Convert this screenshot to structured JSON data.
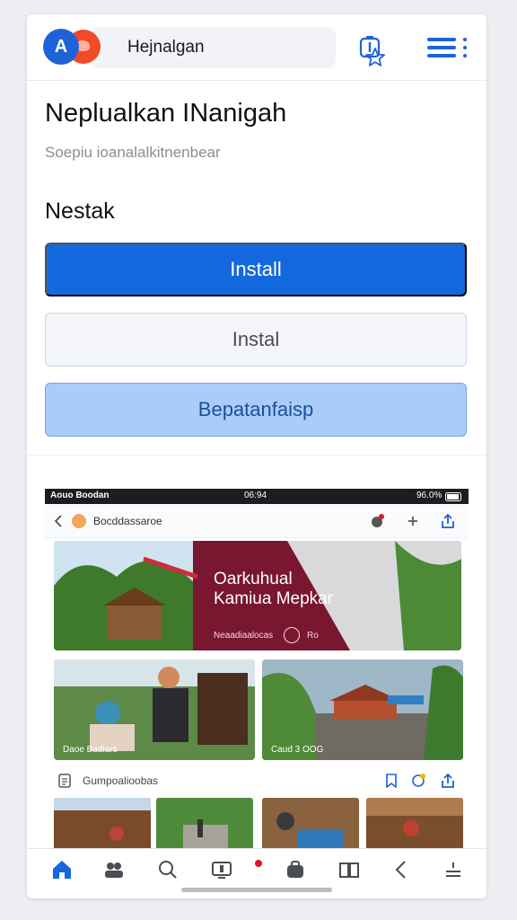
{
  "browser": {
    "logo_letter": "A",
    "address_text": "Hejnalgan",
    "icons": [
      "logo-icon",
      "star-icon",
      "info-icon",
      "menu-icon"
    ]
  },
  "page": {
    "title": "Neplualkan INanigah",
    "subtitle": "Soepiu ioanalalkitnenbear",
    "section_label": "Nestak",
    "buttons": {
      "primary": "Install",
      "secondary": "Instal",
      "tertiary": "Bepatanfaisp"
    }
  },
  "preview": {
    "status_left": "Aouo Boodan",
    "status_time": "06:94",
    "status_right": "96.0%",
    "toolbar_title": "Bocddassaroe",
    "hero_title_line1": "Oarkuhual",
    "hero_title_line2": "Kamiua Mepkar",
    "hero_sub": "Neaadiaalocas",
    "hero_tag": "Ro",
    "thumb_left_caption": "Daoe Badiars",
    "thumb_right_caption": "Caud 3 OOG",
    "row2_title": "Gumpoalioobas"
  },
  "colors": {
    "accent": "#1468de",
    "light_accent": "#a9cdf8",
    "badge_red": "#e0142c"
  }
}
